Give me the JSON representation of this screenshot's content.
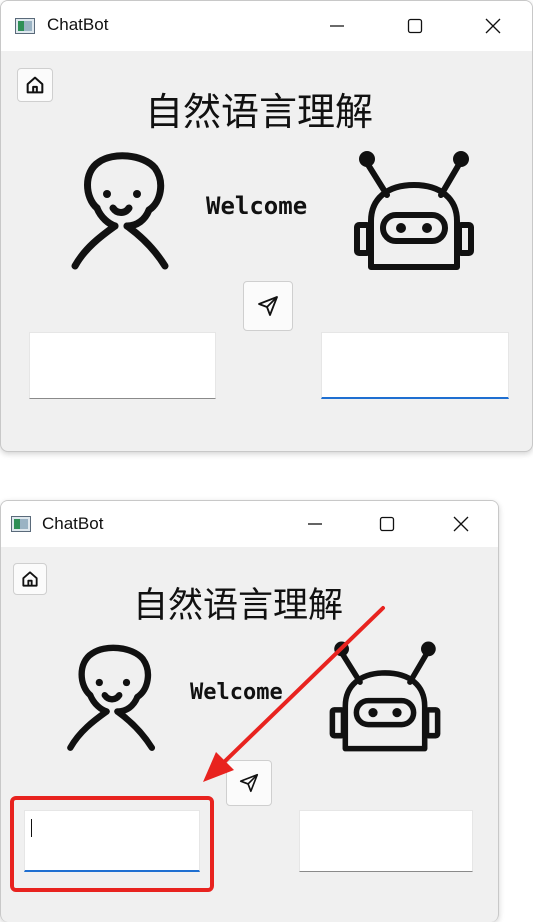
{
  "window": {
    "title": "ChatBot"
  },
  "controls": {
    "minimize": "—",
    "maximize": "☐",
    "close": "✕"
  },
  "heading": "自然语言理解",
  "welcome": "Welcome",
  "icons": {
    "app": "app-window-icon",
    "home": "home-icon",
    "user": "user-avatar-icon",
    "robot": "robot-icon",
    "send": "send-paper-plane-icon"
  },
  "colors": {
    "accent": "#1f6fd1",
    "annotation": "#e8231f",
    "window_bg": "#f0f0f0"
  },
  "user_input": {
    "value": "",
    "placeholder": ""
  },
  "bot_output": {
    "value": "",
    "placeholder": ""
  }
}
